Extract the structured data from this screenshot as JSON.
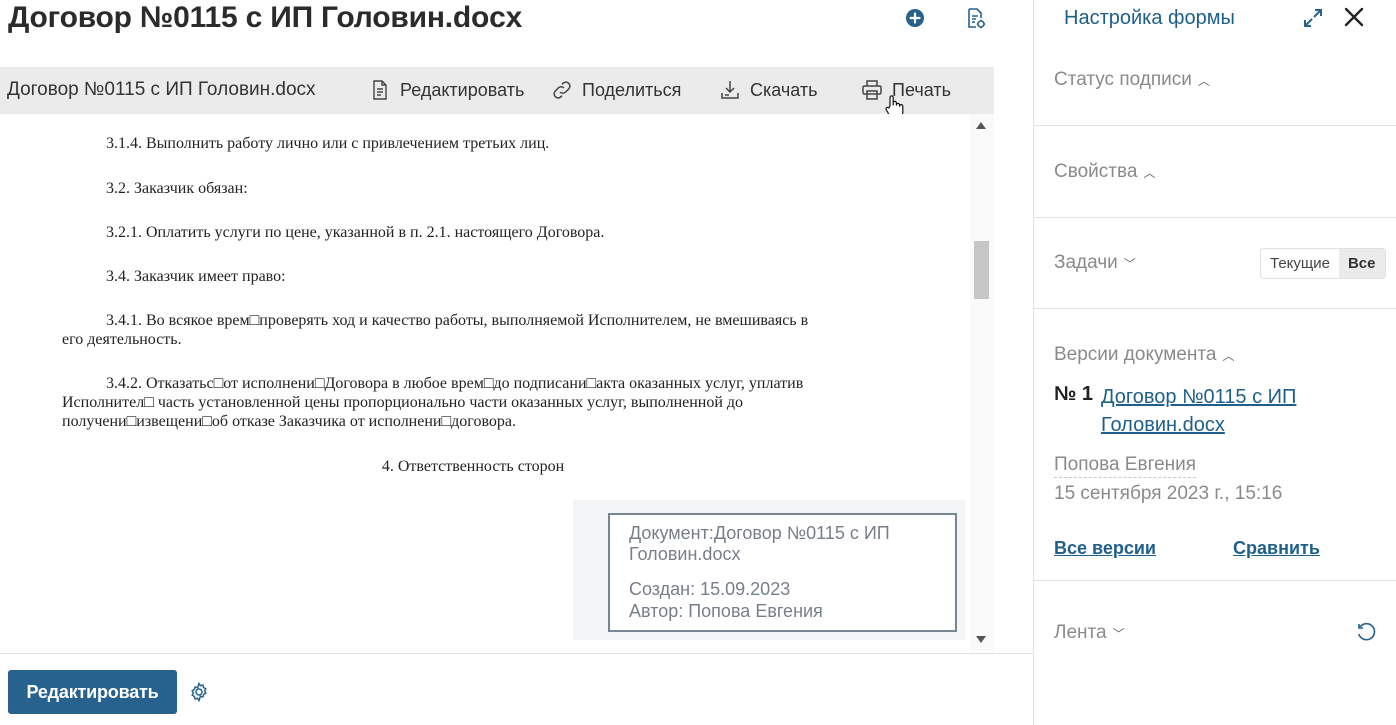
{
  "header": {
    "title": "Договор №0115 с ИП Головин.docx",
    "icons": [
      "add-circle-icon",
      "file-settings-icon"
    ]
  },
  "toolbar": {
    "file_name": "Договор №0115 с ИП Головин.docx",
    "edit_label": "Редактировать",
    "share_label": "Поделиться",
    "download_label": "Скачать",
    "print_label": "Печать"
  },
  "document": {
    "paragraphs": [
      "3.1.4. Выполнить работу лично или с привлечением третьих лиц.",
      "3.2. Заказчик обязан:",
      "3.2.1. Оплатить услуги по цене, указанной в п. 2.1. настоящего Договора.",
      "3.4. Заказчик имеет право:",
      "3.4.1. Во всякое врем□проверять ход и качество работы, выполняемой Исполнителем, не вмешиваясь в",
      "его деятельность.",
      "3.4.2. Отказатьс□от исполнени□Договора в любое врем□до подписани□акта оказанных услуг, уплатив",
      "Исполнител□ часть установленной цены пропорционально части оказанных услуг, выполненной до",
      "получени□извещени□об отказе Заказчика от исполнени□договора."
    ],
    "section_heading": "4. Ответственность сторон",
    "stamp": {
      "line1": "Документ:Договор №0115 с ИП",
      "line2": "Головин.docx",
      "created": "Создан: 15.09.2023",
      "author": "Автор: Попова Евгения"
    }
  },
  "footer": {
    "edit_button": "Редактировать"
  },
  "sidebar": {
    "form_settings": "Настройка формы",
    "sections": {
      "signature_status": "Статус подписи",
      "properties": "Свойства",
      "tasks": "Задачи",
      "versions": "Версии документа",
      "feed": "Лента"
    },
    "tasks_filter": {
      "current": "Текущие",
      "all": "Все",
      "selected": "Все"
    },
    "version": {
      "number": "№ 1",
      "link_line1": "Договор №0115 с ИП",
      "link_line2": "Головин.docx",
      "author": "Попова Евгения",
      "date": "15 сентября 2023 г., 15:16",
      "all_versions": "Все версии",
      "compare": "Сравнить"
    },
    "accent_color": "#27628f",
    "link_color": "#1e5f8c"
  }
}
